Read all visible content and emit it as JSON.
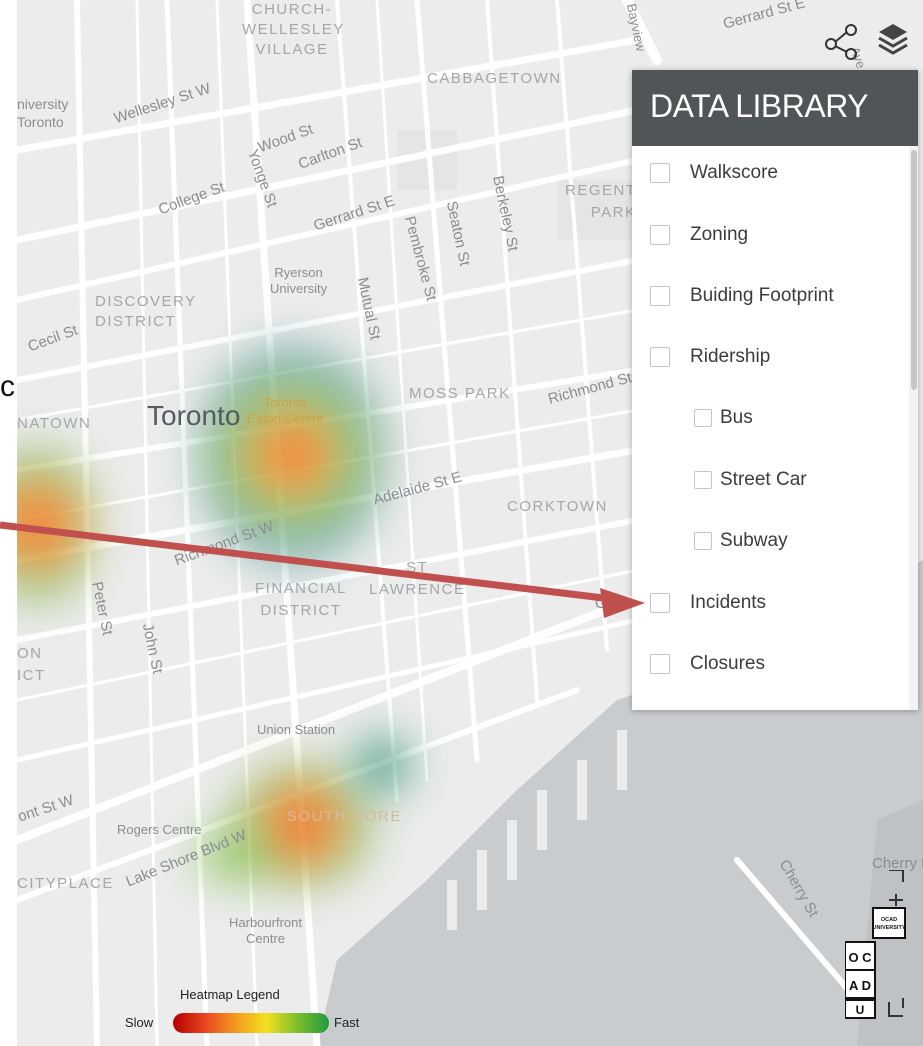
{
  "labels": {
    "church_wellesley": "CHURCH-\nWELLESLEY\nVILLAGE",
    "cabbagetown": "CABBAGETOWN",
    "university": "niversity\nToronto",
    "wellesley_st_w": "Wellesley St W",
    "wood_st": "Wood St",
    "carlton_st": "Carlton St",
    "college_st": "College St",
    "yonge_st": "Yonge St",
    "gerrard_st_e": "Gerrard St E",
    "gerrard_st_e_top": "Gerrard St E",
    "pembroke_st": "Pembroke St",
    "seaton_st": "Seaton St",
    "berkeley_st": "Berkeley St",
    "regent_park": "REGENT\nPARK",
    "ryerson": "Ryerson\nUniversity",
    "mutual_st": "Mutual St",
    "discovery": "DISCOVERY\nDISTRICT",
    "cecil_st": "Cecil St",
    "moss_park": "MOSS PARK",
    "richmond_st_e": "Richmond St",
    "toronto": "Toronto",
    "eaton": "Toronto\nEaton Centre",
    "natown": "NATOWN",
    "adelaide_st_e": "Adelaide St E",
    "corktown": "CORKTOWN",
    "richmond_st_w": "Richmond St W",
    "financial": "FINANCIAL\nDISTRICT",
    "st_lawrence": "ST\nLAWRENCE",
    "peter_st": "Peter St",
    "john_st": "John St",
    "on_ict": "ON\nICT",
    "union_station": "Union Station",
    "front_st_w": "ont St W",
    "rogers_centre": "Rogers Centre",
    "south_core": "SOUTH CORE",
    "lake_shore": "Lake Shore Blvd W",
    "cityplace": "CITYPLACE",
    "harbourfront": "Harbourfront\nCentre",
    "cherry_st": "Cherry St",
    "cherry_b": "Cherry B",
    "bayview": "Bayview",
    "ave": "Ave",
    "g": "G"
  },
  "data_library": {
    "title": "DATA LIBRARY",
    "items": [
      {
        "label": "Walkscore",
        "checked": false
      },
      {
        "label": "Zoning",
        "checked": false
      },
      {
        "label": "Buiding Footprint",
        "checked": false
      },
      {
        "label": "Ridership",
        "checked": false
      },
      {
        "label": "Bus",
        "checked": false
      },
      {
        "label": "Street Car",
        "checked": false
      },
      {
        "label": "Subway",
        "checked": false
      },
      {
        "label": "Incidents",
        "checked": false
      },
      {
        "label": "Closures",
        "checked": false
      }
    ]
  },
  "legend": {
    "title": "Heatmap Legend",
    "slow": "Slow",
    "fast": "Fast",
    "gradient_colors": [
      "#b30000",
      "#e8431f",
      "#f39a1e",
      "#f3e020",
      "#7cbd2c",
      "#1f9c3d"
    ]
  },
  "logo": {
    "top_text": "OCAD\nUNIVERSITY",
    "letters": [
      "O",
      "C",
      "A",
      "D",
      "U"
    ]
  },
  "toolbar": {
    "share_icon": "share-icon",
    "layers_icon": "layers-icon"
  },
  "annotation": {
    "stray_text": "c",
    "arrow_color": "#c0504d"
  },
  "colors": {
    "land": "#ebeceb",
    "water": "#c9ccce",
    "panel_header": "#505558"
  }
}
